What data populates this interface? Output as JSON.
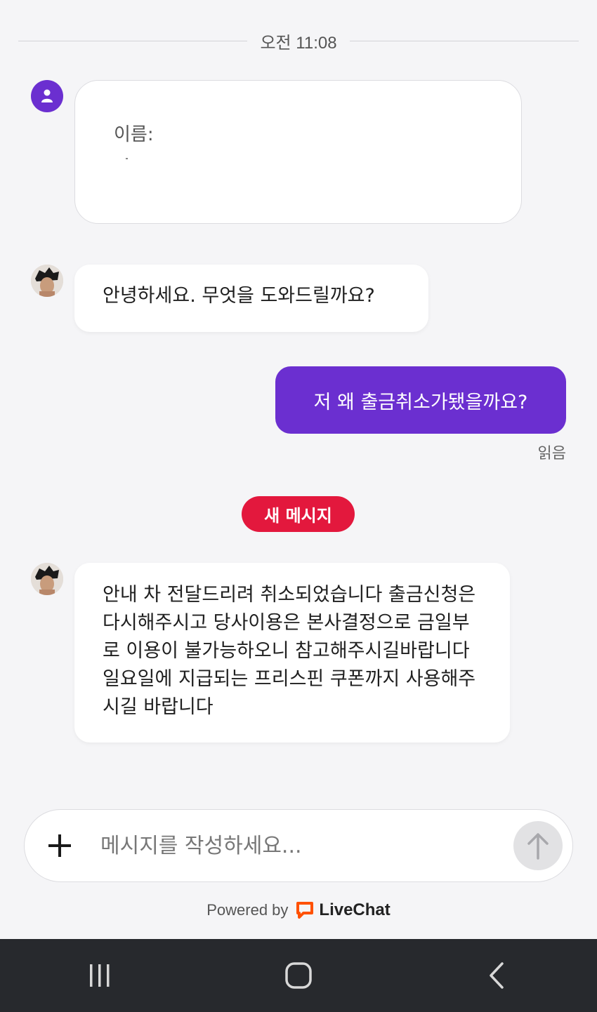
{
  "timestamp": "오전 11:08",
  "form": {
    "label": "이름:",
    "icon": "user-icon"
  },
  "messages": [
    {
      "sender": "agent",
      "text": "안녕하세요. 무엇을 도와드릴까요?"
    },
    {
      "sender": "user",
      "text": "저 왜 출금취소가됐을까요?",
      "status": "읽음"
    },
    {
      "sender": "agent",
      "text": "안내 차 전달드리려 취소되었습니다 출금신청은 다시해주시고 당사이용은 본사결정으로 금일부로 이용이 불가능하오니 참고해주시길바랍니다 일요일에 지급되는 프리스핀 쿠폰까지 사용해주시길 바랍니다"
    }
  ],
  "new_message_badge": "새 메시지",
  "composer": {
    "placeholder": "메시지를 작성하세요...",
    "add_icon": "plus-icon",
    "send_icon": "arrow-up-icon"
  },
  "footer": {
    "powered_by": "Powered by",
    "brand": "LiveChat"
  },
  "colors": {
    "accent": "#6b2fd0",
    "badge": "#e3183d",
    "brand": "#ff5100",
    "navbar": "#27292d"
  },
  "system_nav": [
    "recents-icon",
    "home-icon",
    "back-icon"
  ]
}
